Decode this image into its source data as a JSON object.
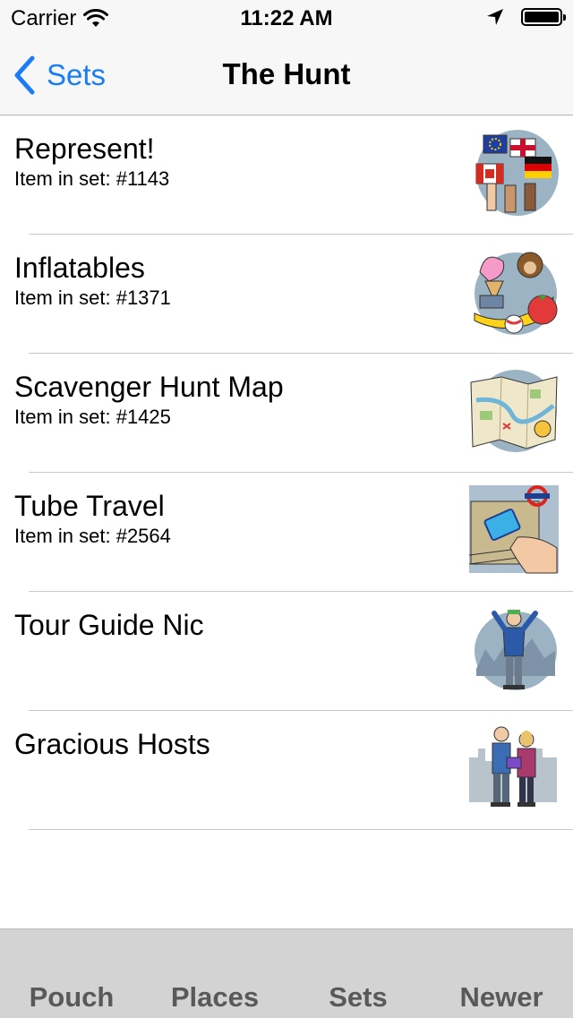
{
  "status_bar": {
    "carrier": "Carrier",
    "time": "11:22 AM",
    "battery_level": 1.0
  },
  "nav": {
    "back_label": "Sets",
    "title": "The Hunt"
  },
  "items": [
    {
      "title": "Represent!",
      "subtitle": "Item in set: #1143",
      "icon": "flags-icon"
    },
    {
      "title": "Inflatables",
      "subtitle": "Item in set: #1371",
      "icon": "inflatables-icon"
    },
    {
      "title": "Scavenger Hunt Map",
      "subtitle": "Item in set: #1425",
      "icon": "map-icon"
    },
    {
      "title": "Tube Travel",
      "subtitle": "Item in set: #2564",
      "icon": "tube-card-icon"
    },
    {
      "title": "Tour Guide Nic",
      "subtitle": "",
      "icon": "tour-guide-icon"
    },
    {
      "title": "Gracious Hosts",
      "subtitle": "",
      "icon": "hosts-icon"
    }
  ],
  "tabs": [
    {
      "label": "Pouch"
    },
    {
      "label": "Places"
    },
    {
      "label": "Sets"
    },
    {
      "label": "Newer"
    }
  ],
  "colors": {
    "accent": "#1a7cf6",
    "bar_background": "#f7f7f7",
    "tab_bar_background": "#d3d3d3",
    "tab_label": "#595959"
  }
}
